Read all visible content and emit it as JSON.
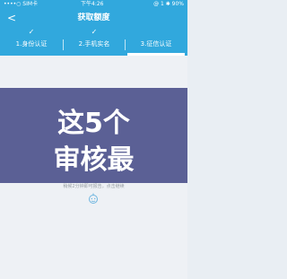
{
  "status": {
    "carrier": "••••○ SIM卡",
    "time": "下午4:26",
    "right": "@ 1 ✱ 90%"
  },
  "nav": {
    "back": "<",
    "title": "获取额度"
  },
  "steps": [
    {
      "check": "✓",
      "label": "1.身份认证"
    },
    {
      "check": "✓",
      "label": "2.手机实名"
    },
    {
      "check": "",
      "label": "3.征信认证"
    }
  ],
  "content": {
    "loading_text": "稍候2分钟即可报告，点击继续"
  },
  "overlay": {
    "line1": "这5个",
    "line2": "审核最"
  }
}
